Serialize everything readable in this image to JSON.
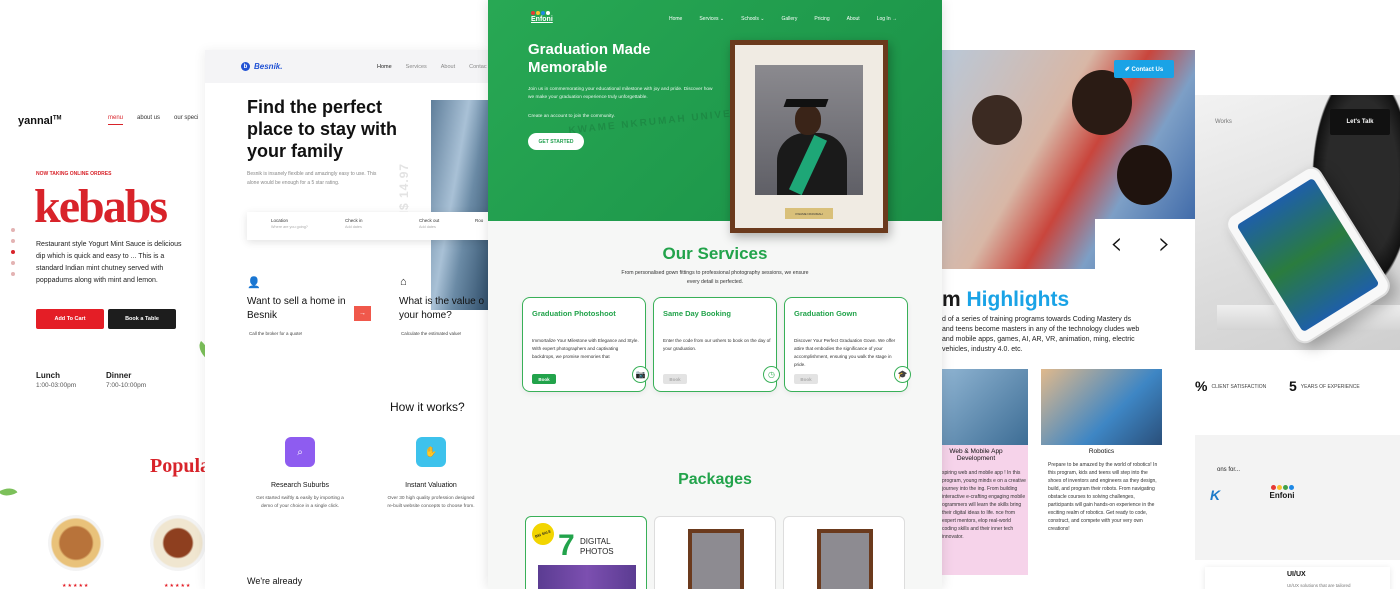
{
  "yannal": {
    "logo": "yannal",
    "tm": "TM",
    "nav": [
      "menu",
      "about us",
      "our speci"
    ],
    "kicker": "NOW TAKING ONLINE ORDRES",
    "title": "kebabs",
    "desc": "Restaurant style Yogurt Mint Sauce is delicious dip which is quick and easy to ... This is a standard Indian mint chutney served with poppadums along with mint and lemon.",
    "add_to_cart": "Add To Cart",
    "book_table": "Book a Table",
    "lunch_label": "Lunch",
    "lunch_hours": "1:00-03:00pm",
    "dinner_label": "Dinner",
    "dinner_hours": "7:00-10:00pm",
    "popular": "Popula",
    "stars": "★★★★★"
  },
  "besnik": {
    "logo": "Besnik.",
    "nav": [
      "Home",
      "Services",
      "About",
      "Contac"
    ],
    "headline": "Find the perfect place to stay with your family",
    "desc": "Besnik is insanely flexible and amazingly easy to use. This alone would be enough for a 5 star rating.",
    "price": "GH$ 14.97",
    "search": [
      {
        "label": "Location",
        "placeholder": "Where are you going?"
      },
      {
        "label": "Check in",
        "placeholder": "Add dates"
      },
      {
        "label": "Check out",
        "placeholder": "Add dates"
      },
      {
        "label": "Roo",
        "placeholder": ""
      }
    ],
    "sell_title": "Want to sell a home in Besnik",
    "sell_sub": "Call the broker for a quote!",
    "value_title": "What is the value o your home?",
    "value_sub": "Calculate the estimated value!",
    "how": "How it works?",
    "feature1_title": "Research Suburbs",
    "feature1_desc": "Get started swiftly & easily by importing a  demo of your choice in a single click.",
    "feature2_title": "Instant Valuation",
    "feature2_desc": "Over 30 high quality profession designed re-built website concepts to choose from.",
    "already": "We're already"
  },
  "enfoni": {
    "logo": "Enfoni",
    "nav": [
      "Home",
      "Services ⌄",
      "Schools ⌄",
      "Gallery",
      "Pricing",
      "About",
      "Log In →"
    ],
    "hero_title": "Graduation Made Memorable",
    "hero_desc": "Join us in commemorating your educational milestone with joy and pride. Discover how we make your graduation experience truly unforgettable.",
    "hero_desc2": "Create an account to join the community.",
    "cta": "GET STARTED",
    "watermark": "KWAME NKRUMAH UNIVERSITY",
    "plaque": "KWAME NKRUMAH",
    "services_title": "Our Services",
    "services_desc": "From personalised gown fittings to professional photography sessions, we ensure every detail is perfected.",
    "cards": [
      {
        "title": "Graduation Photoshoot",
        "text": "Immortalize Your Milestone with Elegance and Style. With expert photographers and captivating backdrops, we promise memories that",
        "book": "Book",
        "icon": "📷"
      },
      {
        "title": "Same Day Booking",
        "text": "Enter the code from our ushers to book on the day of your graduation.",
        "book": "Book",
        "icon": "◷"
      },
      {
        "title": "Graduation Gown",
        "text": "Discover Your Perfect Graduation Gown. We offer attire that embodies the significance of your accomplishment, ensuring you walk the stage in pride.",
        "book": "Book",
        "icon": "🎓"
      }
    ],
    "packages_title": "Packages",
    "sale_badge": "BIG SALE",
    "package_count": "7",
    "package_label": "DIGITAL PHOTOS"
  },
  "highlights": {
    "contact": "✐ Contact Us",
    "title_prefix": "m ",
    "title_accent": "Highlights",
    "desc": "d of a series of training programs towards Coding Mastery ds and teens become masters in any of the technology cludes web and mobile apps, games, AI, AR, VR, animation, ming, electric vehicles, industry 4.0. etc.",
    "card1_title": "Web & Mobile App Development",
    "card1_text": "spiring web and mobile app ! In this program, young minds e on a creative journey into the ing. From building interactive e-crafting engaging mobile ogrammers will learn the skills bring their digital ideas to life. nce from expert mentors, elop real-world coding skills and their inner tech innovator.",
    "card2_title": "Robotics",
    "card2_text": "Prepare to be amazed by the world of robotics! In this program, kids and teens will step into the shoes of inventors and engineers as they design, build, and program their robots. From navigating obstacle courses to solving challenges, participants will gain hands-on experience in the exciting realm of robotics. Get ready to code, construct, and compete with your very own creations!"
  },
  "agency": {
    "nav": "Works",
    "talk": "Let's Talk",
    "stat1_value": "%",
    "stat1_label": "CLIENT SATISFACTION",
    "stat2_value": "5",
    "stat2_label": "YEARS OF EXPERIENCE",
    "partners": "ons for...",
    "kr_logo": "K",
    "enfoni_logo": "Enfoni",
    "uiux": "UI/UX",
    "uiux_sub": "UI/UX solutions that are tailored"
  },
  "slider": {
    "prev": "‹",
    "next": "›"
  },
  "colors": {
    "red": "#e41e26",
    "green": "#22a34b",
    "blue": "#1aa3e6",
    "besnik_blue": "#2152d4"
  }
}
